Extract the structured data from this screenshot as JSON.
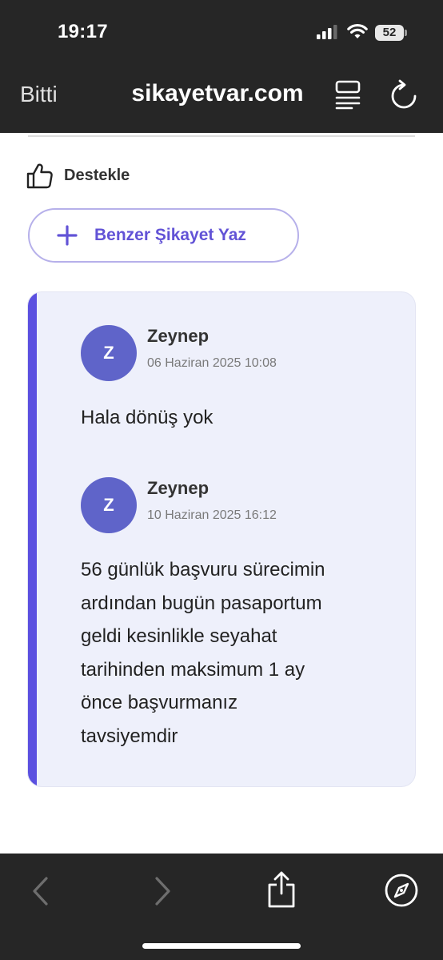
{
  "status_bar": {
    "time": "19:17",
    "battery": "52"
  },
  "browser": {
    "done_label": "Bitti",
    "url": "sikayetvar.com"
  },
  "actions": {
    "support_label": "Destekle",
    "similar_complaint_label": "Benzer Şikayet Yaz"
  },
  "comments": [
    {
      "avatar_letter": "Z",
      "author": "Zeynep",
      "timestamp": "06 Haziran 2025 10:08",
      "text": "Hala dönüş yok"
    },
    {
      "avatar_letter": "Z",
      "author": "Zeynep",
      "timestamp": "10 Haziran 2025 16:12",
      "text_lines": [
        "56 günlük başvuru sürecimin",
        "ardından bugün pasaportum",
        "geldi kesinlikle seyahat",
        "tarihinden maksimum 1 ay",
        "önce başvurmanız",
        "tavsiyemdir"
      ]
    }
  ],
  "colors": {
    "accent": "#5b50e0",
    "button_text": "#6253d6",
    "avatar_bg": "#5f64c9",
    "thread_bg": "#eef0fb",
    "chrome_bg": "#262626"
  },
  "icons": {
    "reader": "reader-mode-icon",
    "reload": "reload-icon",
    "support": "thumbs-up-icon",
    "plus": "plus-icon",
    "back": "back-chevron-icon",
    "forward": "forward-chevron-icon",
    "share": "share-icon",
    "safari": "compass-icon"
  }
}
